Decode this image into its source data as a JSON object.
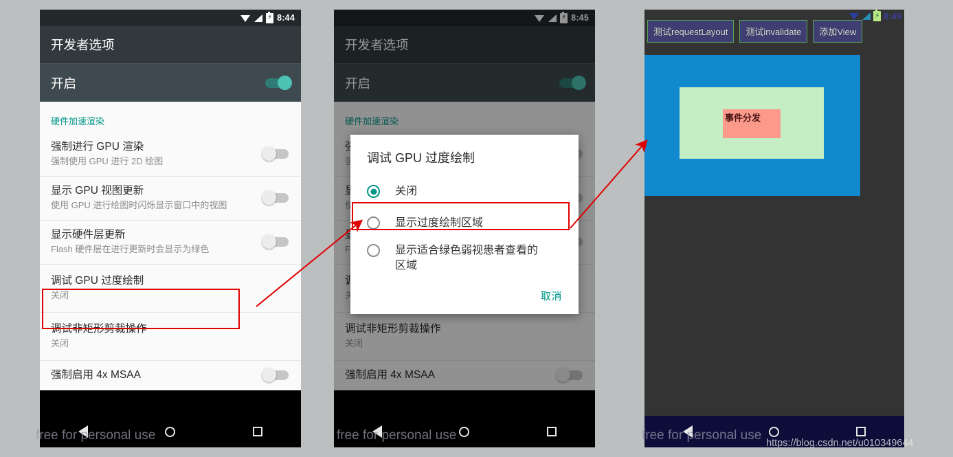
{
  "phone1": {
    "status": {
      "time": "8:44",
      "wifi_icon": "wifi-icon",
      "signal_icon": "signal-icon",
      "battery_icon": "battery-charging-icon"
    },
    "appbar_title": "开发者选项",
    "master_switch": {
      "label": "开启",
      "state": "on"
    },
    "section_header": "硬件加速渲染",
    "rows": [
      {
        "title": "强制进行 GPU 渲染",
        "subtitle": "强制使用 GPU 进行 2D 绘图",
        "toggle": "off"
      },
      {
        "title": "显示 GPU 视图更新",
        "subtitle": "使用 GPU 进行绘图时闪烁显示窗口中的视图",
        "toggle": "off"
      },
      {
        "title": "显示硬件层更新",
        "subtitle": "Flash 硬件层在进行更新时会显示为绿色",
        "toggle": "off"
      },
      {
        "title": "调试 GPU 过度绘制",
        "subtitle": "关闭",
        "toggle": "none"
      },
      {
        "title": "调试非矩形剪裁操作",
        "subtitle": "关闭",
        "toggle": "none"
      },
      {
        "title": "强制启用 4x MSAA",
        "subtitle": "",
        "toggle": "off"
      }
    ],
    "nav": {
      "back": "back-icon",
      "home": "home-icon",
      "recents": "recents-icon"
    }
  },
  "phone2": {
    "status": {
      "time": "8:45"
    },
    "appbar_title": "开发者选项",
    "master_switch": {
      "label": "开启",
      "state": "on"
    },
    "section_header": "硬件加速渲染",
    "rows": [
      {
        "title": "强",
        "subtitle": "强"
      },
      {
        "title": "显",
        "subtitle": "使"
      },
      {
        "title": "显",
        "subtitle": "Fl"
      },
      {
        "title": "调",
        "subtitle": "关闭"
      },
      {
        "title": "调试非矩形剪裁操作",
        "subtitle": "关闭"
      },
      {
        "title": "强制启用 4x MSAA",
        "subtitle": ""
      }
    ],
    "dialog": {
      "title": "调试 GPU 过度绘制",
      "options": [
        {
          "label": "关闭",
          "selected": true
        },
        {
          "label": "显示过度绘制区域",
          "selected": false
        },
        {
          "label": "显示适合绿色弱视患者查看的区域",
          "selected": false
        }
      ],
      "cancel": "取消"
    }
  },
  "phone3": {
    "status": {
      "time": "8:49"
    },
    "buttons": [
      "测试requestLayout",
      "测试invalidate",
      "添加View"
    ],
    "canvas": {
      "outer_color": "#1189ce",
      "middle_color": "#c5eec5",
      "inner_color": "#fb9a8b",
      "inner_label": "事件分发"
    }
  },
  "annotations": {
    "highlight_1": "调试 GPU 过度绘制",
    "highlight_2": "显示过度绘制区域",
    "arrow_color": "#e00000"
  },
  "watermarks": {
    "personal_use": "free for personal use",
    "url": "https://blog.csdn.net/u010349644"
  }
}
